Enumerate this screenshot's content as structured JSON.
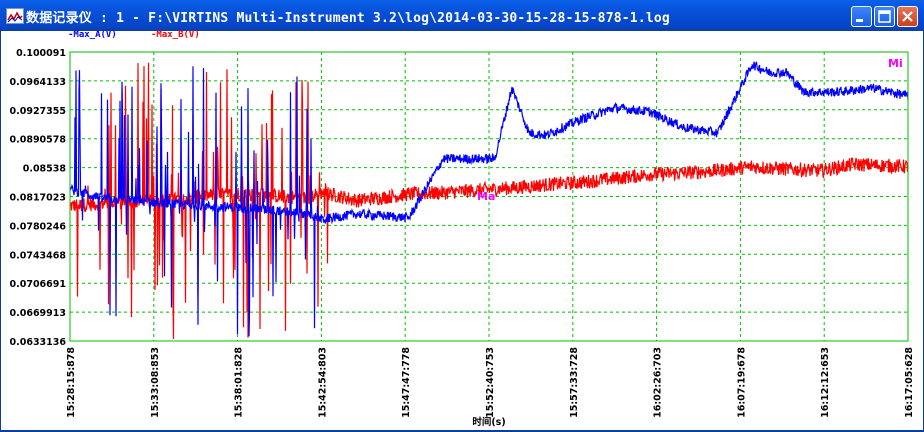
{
  "window": {
    "title": "数据记录仪 : 1 - F:\\VIRTINS Multi-Instrument 3.2\\log\\2014-03-30-15-28-15-878-1.log",
    "buttons": [
      "minimize-icon",
      "maximize-icon",
      "close-icon"
    ]
  },
  "legend": {
    "a_label": "Max_A(V)",
    "b_label": "Max_B(V)"
  },
  "markers": {
    "max_label": "Ma",
    "min_label": "Mi"
  },
  "colors": {
    "title_bar": "#0750d8",
    "channel_a": "#0000ff",
    "channel_b": "#ff0000",
    "grid": "#00c000",
    "marker": "#ff00ff"
  },
  "chart_data": {
    "type": "line",
    "title": "",
    "xlabel": "时间(s)",
    "ylabel": "",
    "y_tick_labels": [
      "0.100091",
      "0.0964133",
      "0.0927355",
      "0.0890578",
      "0.08538",
      "0.0817023",
      "0.0780246",
      "0.0743468",
      "0.0706691",
      "0.0669913",
      "0.0633136"
    ],
    "x_tick_labels": [
      "15:28:15:878",
      "15:33:08:853",
      "15:38:01:828",
      "15:42:54:803",
      "15:47:47:778",
      "15:52:40:753",
      "15:57:33:728",
      "16:02:26:703",
      "16:07:19:678",
      "16:12:12:653",
      "16:17:05:628"
    ],
    "ylim": [
      0.0633136,
      0.100091
    ],
    "grid": true,
    "legend_position": "top-left",
    "series": [
      {
        "name": "Max_A(V)",
        "color": "#0000ff",
        "x": [
          "15:28:15",
          "15:30:00",
          "15:32:00",
          "15:34:00",
          "15:36:00",
          "15:38:00",
          "15:40:00",
          "15:42:00",
          "15:43:00",
          "15:45:00",
          "15:48:00",
          "15:50:00",
          "15:51:00",
          "15:53:00",
          "15:54:00",
          "15:55:00",
          "15:56:00",
          "15:58:00",
          "16:00:00",
          "16:02:00",
          "16:04:00",
          "16:06:00",
          "16:08:00",
          "16:09:00",
          "16:10:00",
          "16:11:00",
          "16:13:00",
          "16:15:00",
          "16:17:05"
        ],
        "values": [
          0.0826,
          0.0815,
          0.0812,
          0.0808,
          0.0805,
          0.0803,
          0.08,
          0.0795,
          0.0788,
          0.0795,
          0.079,
          0.0865,
          0.0865,
          0.0865,
          0.0955,
          0.0898,
          0.0895,
          0.0915,
          0.093,
          0.0925,
          0.0905,
          0.0898,
          0.0985,
          0.0975,
          0.0975,
          0.095,
          0.095,
          0.0955,
          0.0945
        ]
      },
      {
        "name": "Max_B(V)",
        "color": "#ff0000",
        "x": [
          "15:28:15",
          "15:30:00",
          "15:32:00",
          "15:34:00",
          "15:36:00",
          "15:38:00",
          "15:40:00",
          "15:42:00",
          "15:43:00",
          "15:45:00",
          "15:48:00",
          "15:50:00",
          "15:52:00",
          "15:54:00",
          "15:56:00",
          "15:58:00",
          "16:00:00",
          "16:02:00",
          "16:04:00",
          "16:06:00",
          "16:08:00",
          "16:10:00",
          "16:12:00",
          "16:14:00",
          "16:17:05"
        ],
        "values": [
          0.0805,
          0.0808,
          0.081,
          0.0812,
          0.0818,
          0.082,
          0.0818,
          0.0815,
          0.0822,
          0.0812,
          0.082,
          0.0822,
          0.0825,
          0.0828,
          0.0832,
          0.0835,
          0.084,
          0.0845,
          0.0847,
          0.085,
          0.0855,
          0.0852,
          0.085,
          0.0858,
          0.0855
        ]
      }
    ]
  }
}
